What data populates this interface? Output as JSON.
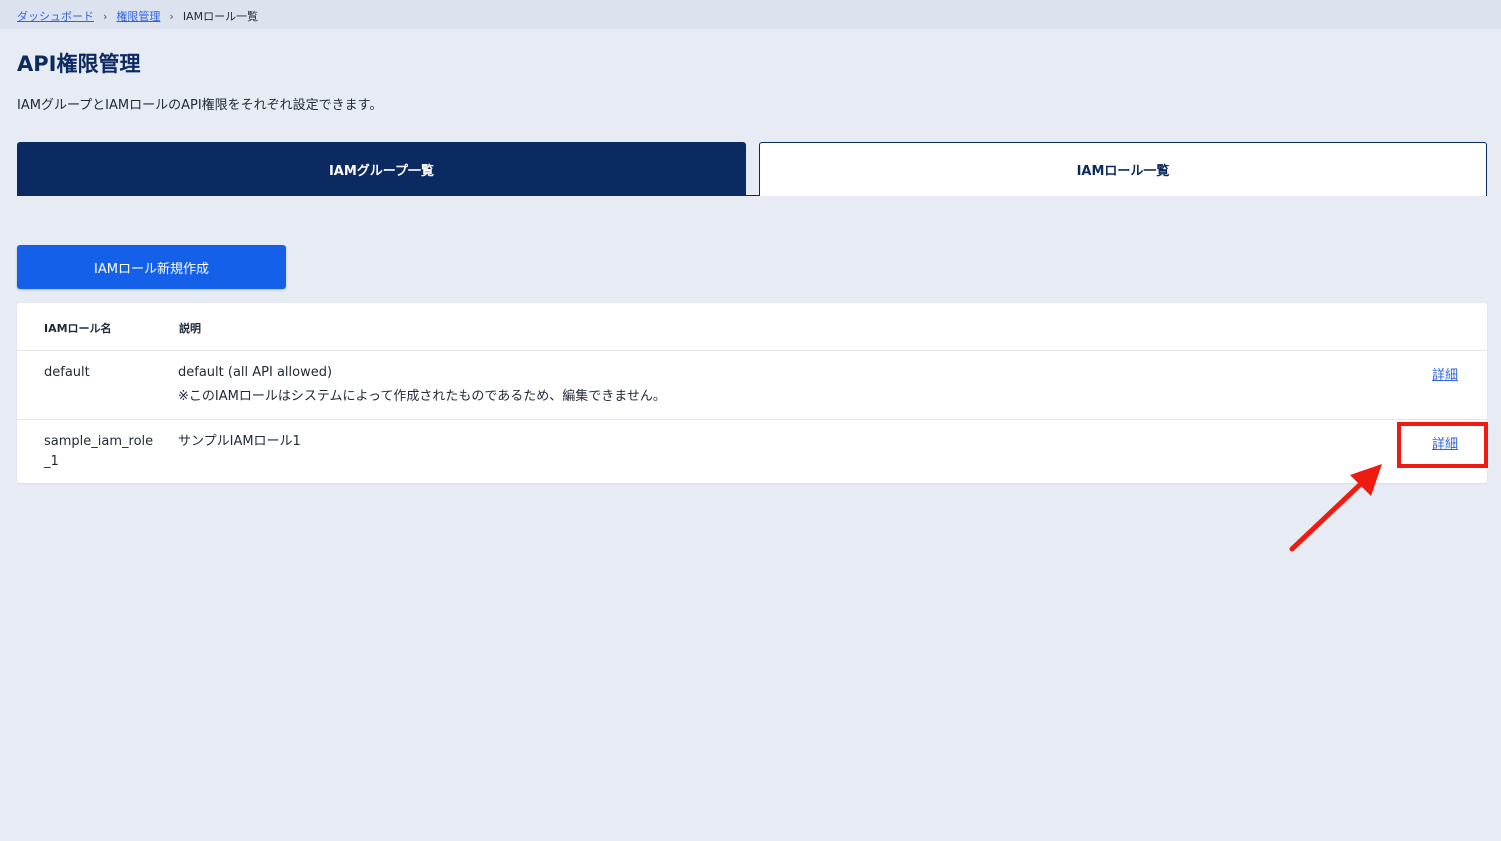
{
  "breadcrumb": {
    "items": [
      "ダッシュボード",
      "権限管理"
    ],
    "separator": "›",
    "current": "IAMロール一覧"
  },
  "page": {
    "title": "API権限管理",
    "description": "IAMグループとIAMロールのAPI権限をそれぞれ設定できます。"
  },
  "tabs": {
    "groups": "IAMグループ一覧",
    "roles": "IAMロール一覧"
  },
  "actions": {
    "create_role": "IAMロール新規作成"
  },
  "table": {
    "headers": {
      "name": "IAMロール名",
      "description": "説明"
    },
    "rows": [
      {
        "name": "default",
        "description": "default (all API allowed)",
        "note": "※このIAMロールはシステムによって作成されたものであるため、編集できません。",
        "action": "詳細"
      },
      {
        "name": "sample_iam_role_1",
        "description": "サンプルIAMロール1",
        "note": "",
        "action": "詳細"
      }
    ]
  },
  "colors": {
    "navy": "#0c2a62",
    "primary": "#1560e8",
    "link": "#2f63e0",
    "annotation": "#f01b10"
  }
}
